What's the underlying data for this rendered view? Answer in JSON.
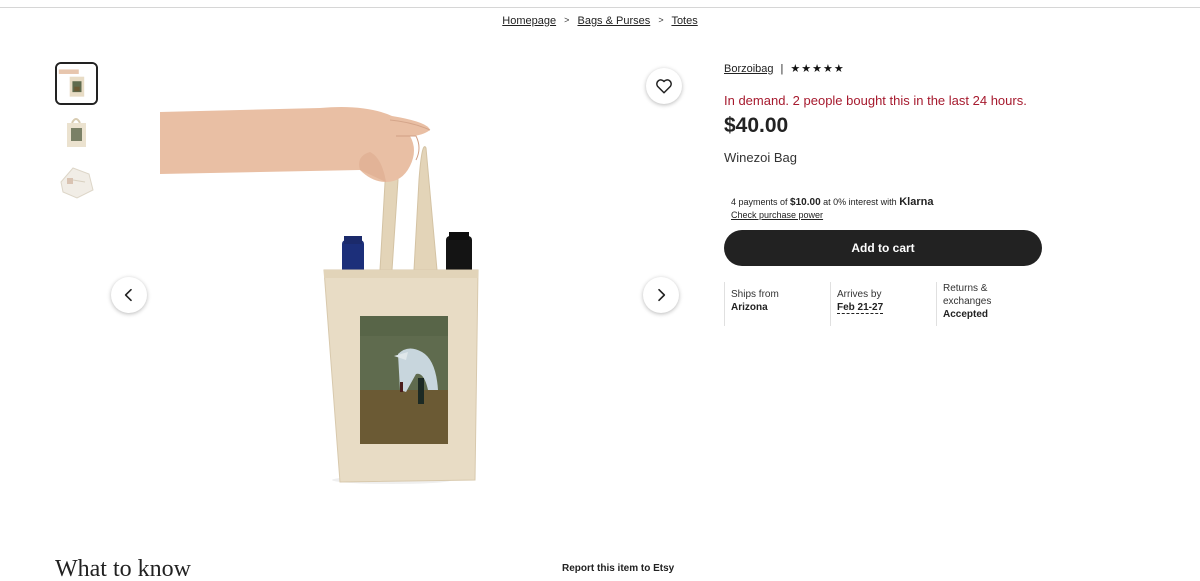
{
  "breadcrumb": {
    "items": [
      "Homepage",
      "Bags & Purses",
      "Totes"
    ],
    "separator": ">"
  },
  "gallery": {
    "thumbnails": [
      "thumb-hand-held-tote",
      "thumb-tote-front",
      "thumb-tote-folded"
    ],
    "active_index": 0,
    "favorite_icon": "heart-icon",
    "prev_icon": "chevron-left-icon",
    "next_icon": "chevron-right-icon"
  },
  "shop": {
    "name": "Borzoibag",
    "divider": "|",
    "stars": "★★★★★",
    "rating": 5
  },
  "listing": {
    "demand_text": "In demand. 2 people bought this in the last 24 hours.",
    "price": "$40.00",
    "title": "Winezoi Bag"
  },
  "klarna": {
    "prefix": "4 payments of",
    "amount": "$10.00",
    "middle": "at 0% interest with",
    "brand": "Klarna",
    "check_link": "Check purchase power"
  },
  "actions": {
    "add_to_cart": "Add to cart"
  },
  "shipping": {
    "ships_from_label": "Ships from",
    "ships_from_value": "Arizona",
    "arrives_label": "Arrives by",
    "arrives_value": "Feb 21-27",
    "returns_label_1": "Returns &",
    "returns_label_2": "exchanges",
    "returns_value": "Accepted"
  },
  "footer": {
    "what_to_know": "What to know",
    "report": "Report this item to Etsy"
  },
  "colors": {
    "demand": "#a61a2e",
    "cart_button": "#222222",
    "tote_canvas": "#e8dcc5",
    "painting_sky": "#5f6b4e",
    "painting_ground": "#6b5a34"
  }
}
